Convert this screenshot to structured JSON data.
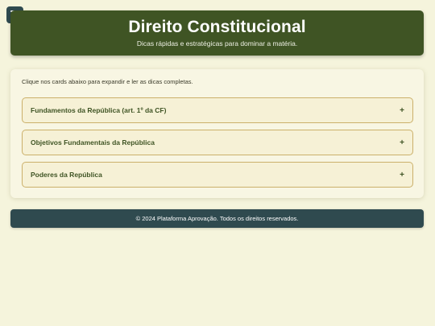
{
  "header": {
    "title": "Direito Constitucional",
    "subtitle": "Dicas rápidas e estratégicas para dominar a matéria."
  },
  "panel": {
    "intro": "Clique nos cards abaixo para expandir e ler as dicas completas.",
    "cards": [
      {
        "title": "Fundamentos da República (art. 1º da CF)",
        "toggle": "+"
      },
      {
        "title": "Objetivos Fundamentais da República",
        "toggle": "+"
      },
      {
        "title": "Poderes da República",
        "toggle": "+"
      }
    ]
  },
  "footer": {
    "text": "© 2024 Plataforma Aprovação. Todos os direitos reservados."
  },
  "icons": {
    "menu": "hamburger-menu-icon",
    "expand": "plus-icon"
  },
  "colors": {
    "background": "#f5f4dc",
    "header": "#3f5424",
    "footer": "#2f4a4f",
    "card_border": "#cbb06a"
  }
}
